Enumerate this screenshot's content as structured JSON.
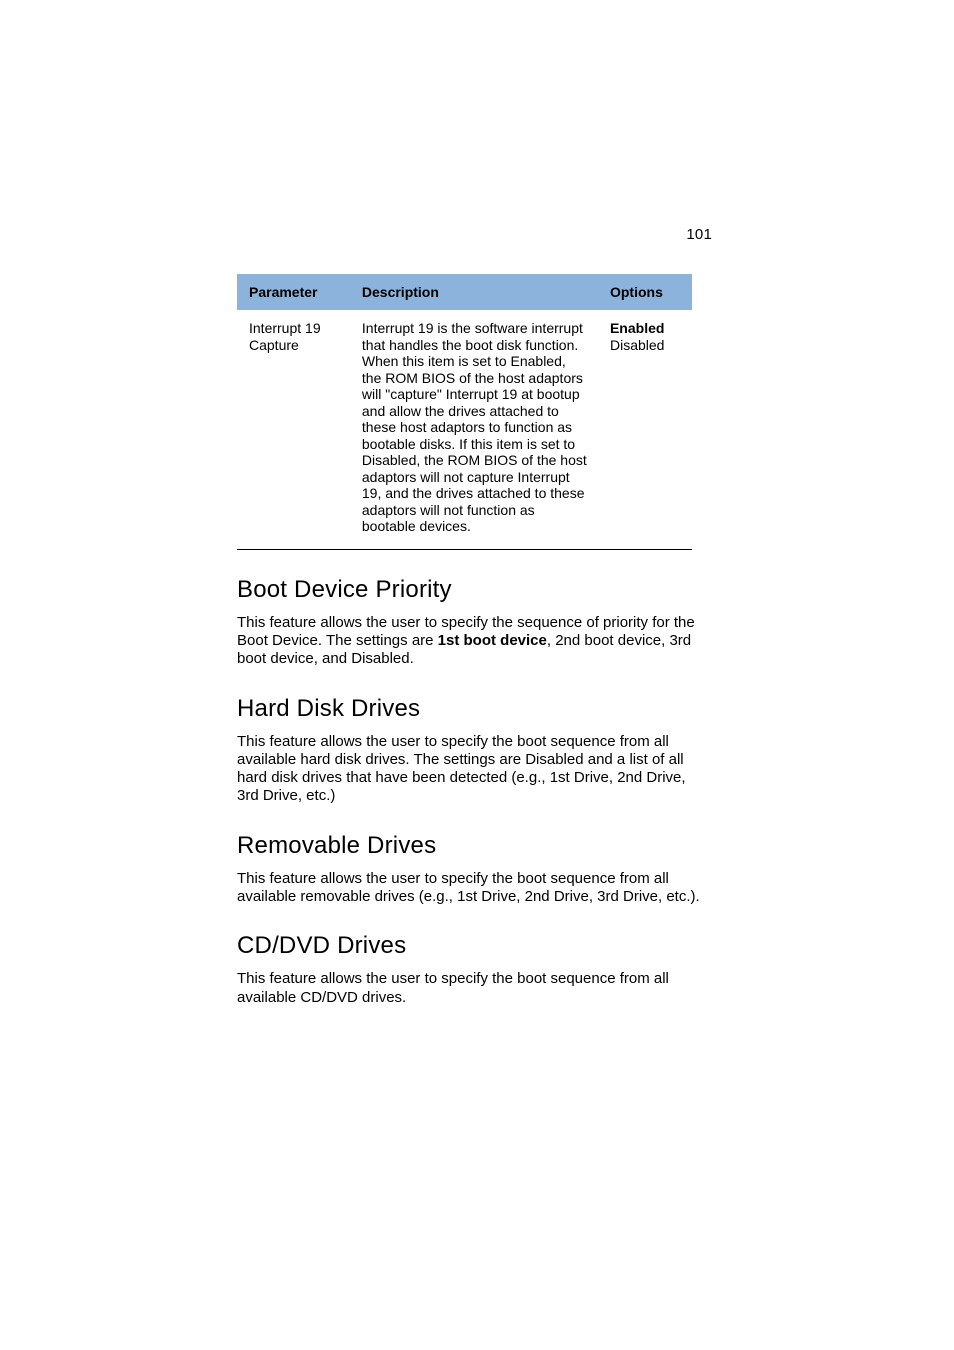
{
  "page_number": "101",
  "table": {
    "headers": {
      "parameter": "Parameter",
      "description": "Description",
      "options": "Options"
    },
    "row": {
      "parameter": "Interrupt 19 Capture",
      "description": "Interrupt 19 is the software interrupt that handles the boot disk function. When this item is set to Enabled, the ROM BIOS of the host adaptors will \"capture\" Interrupt 19 at bootup and allow the drives attached to these host adaptors to function as bootable disks. If this item is set to Disabled, the ROM BIOS of the host adaptors will not capture Interrupt 19, and the drives attached to these adaptors will not function as bootable devices.",
      "option_enabled": "Enabled",
      "option_disabled": "Disabled"
    }
  },
  "sections": {
    "boot_priority": {
      "title": "Boot Device Priority",
      "text_before": "This feature allows the user to specify the sequence of priority for the Boot Device. The settings are ",
      "bold": "1st boot device",
      "text_after": ", 2nd boot device, 3rd boot device, and Disabled."
    },
    "hard_disk": {
      "title": "Hard Disk Drives",
      "text": "This feature allows the user to specify the boot sequence from all available hard disk drives. The settings are Disabled and a list of all hard disk drives that have been detected (e.g., 1st Drive, 2nd Drive, 3rd Drive, etc.)"
    },
    "removable": {
      "title": "Removable Drives",
      "text": "This feature allows the user to specify the boot sequence from all available removable drives (e.g., 1st Drive, 2nd Drive, 3rd Drive, etc.)."
    },
    "cddvd": {
      "title": "CD/DVD Drives",
      "text": "This feature allows the user to specify the boot sequence from all available CD/DVD drives."
    }
  }
}
